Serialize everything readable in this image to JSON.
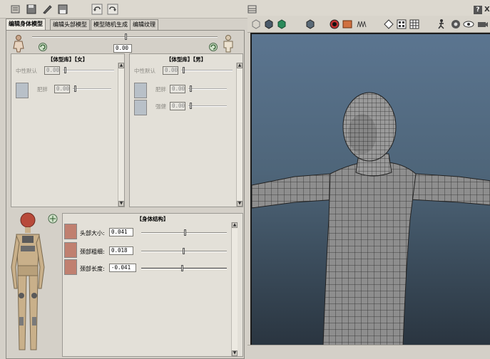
{
  "tabs": [
    {
      "label": "编辑身体模型",
      "active": true
    },
    {
      "label": "编辑头部模型",
      "active": false
    },
    {
      "label": "模型随机生成",
      "active": false
    },
    {
      "label": "编辑纹理",
      "active": false
    }
  ],
  "gender_slider": {
    "value": "0.00"
  },
  "library_female": {
    "title": "【体型库】【女】",
    "rows": [
      {
        "label": "中性默认",
        "value": "0.00"
      },
      {
        "label": "肥胖",
        "value": "0.00"
      }
    ]
  },
  "library_male": {
    "title": "【体型库】【男】",
    "rows": [
      {
        "label": "中性默认",
        "value": "0.00"
      },
      {
        "label": "肥胖",
        "value": "0.00"
      },
      {
        "label": "强健",
        "value": "0.00"
      }
    ]
  },
  "body_structure": {
    "title": "【身体结构】",
    "rows": [
      {
        "label": "头部大小:",
        "value": "0.041",
        "level": 0.5
      },
      {
        "label": "颈部粗细:",
        "value": "0.018",
        "level": 0.5
      },
      {
        "label": "颈部长度:",
        "value": "-0.041",
        "level": 0.48
      }
    ]
  },
  "window_controls": {
    "help": "?",
    "close": "X"
  },
  "colors": {
    "viewport_top": "#5b7590",
    "viewport_bottom": "#2a3540",
    "panel": "#d4d0c8",
    "mesh": "#b8b8b8"
  }
}
